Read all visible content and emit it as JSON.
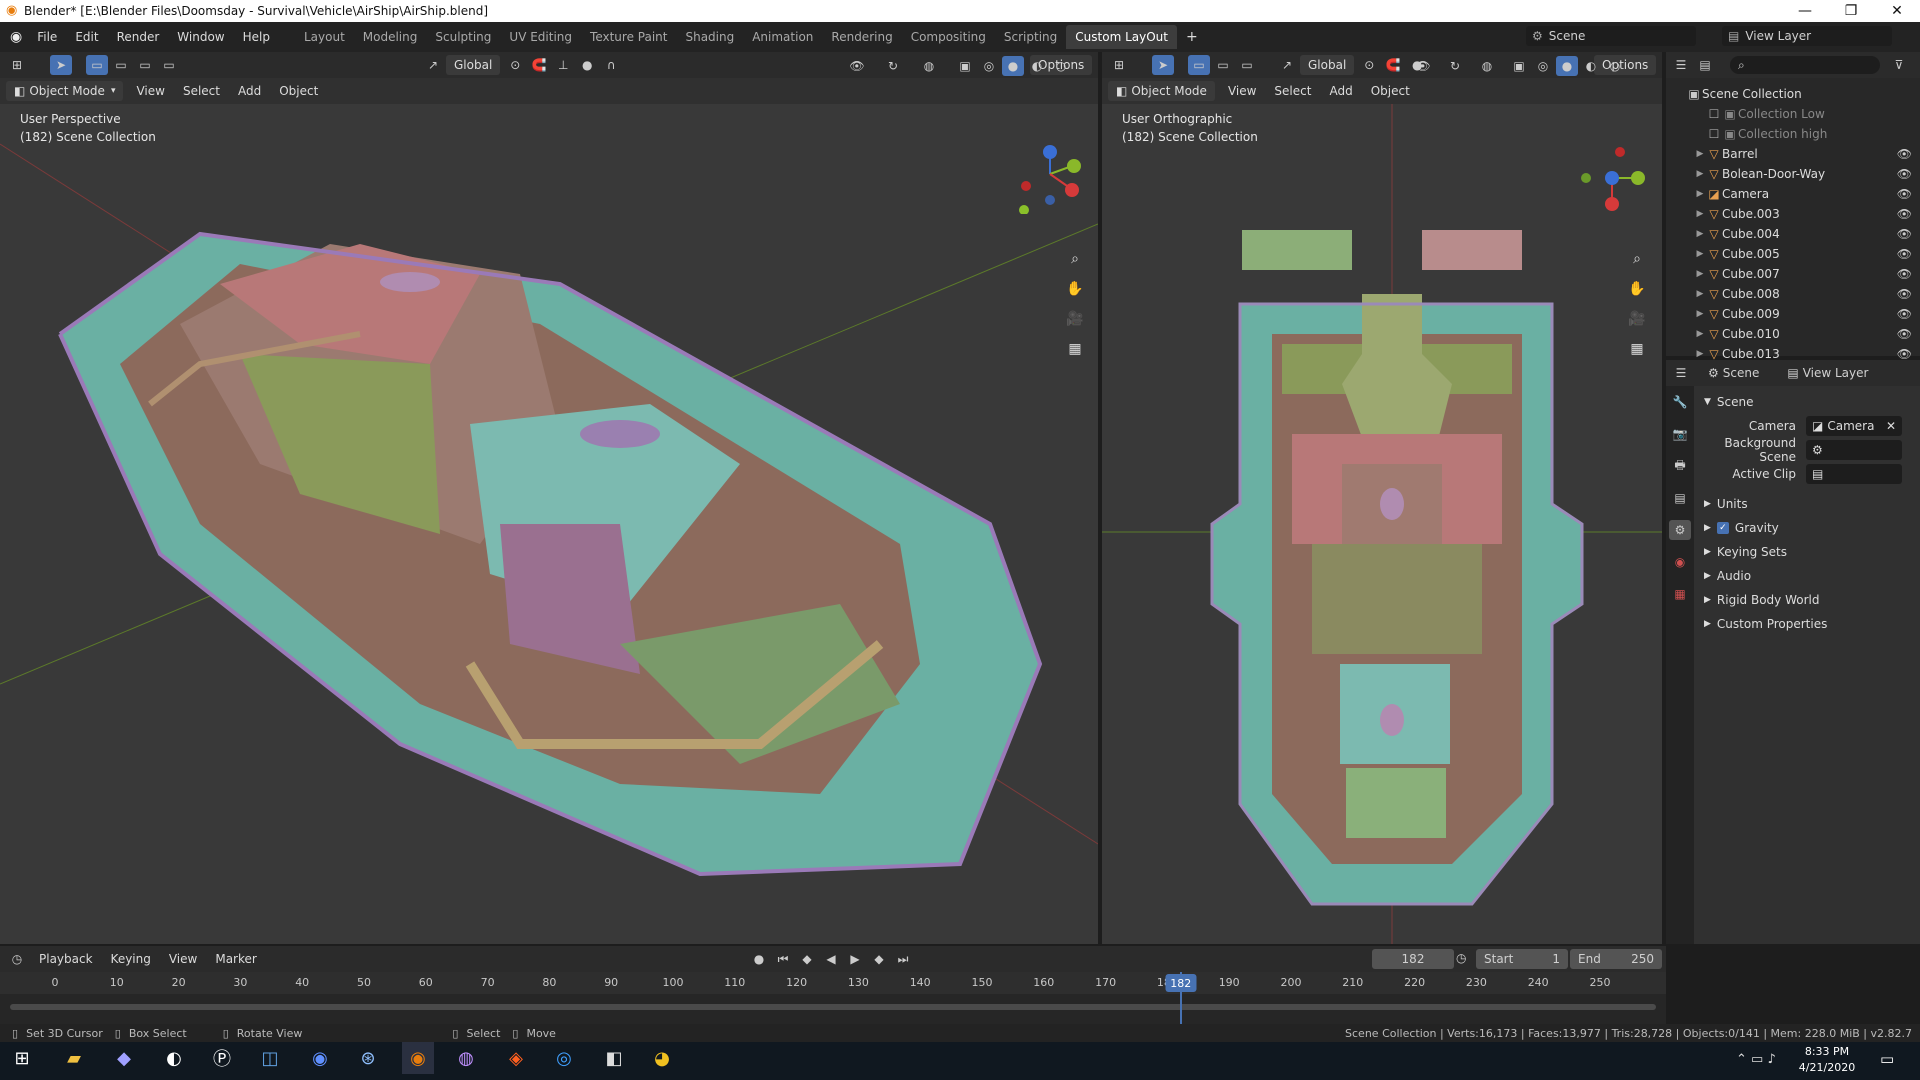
{
  "window": {
    "title": "Blender* [E:\\Blender Files\\Doomsday - Survival\\Vehicle\\AirShip\\AirShip.blend]"
  },
  "menu": [
    "File",
    "Edit",
    "Render",
    "Window",
    "Help"
  ],
  "workspaces": [
    "Layout",
    "Modeling",
    "Sculpting",
    "UV Editing",
    "Texture Paint",
    "Shading",
    "Animation",
    "Rendering",
    "Compositing",
    "Scripting",
    "Custom LayOut"
  ],
  "active_workspace": "Custom LayOut",
  "scene_selector": {
    "scene": "Scene",
    "view_layer": "View Layer"
  },
  "viewport_left": {
    "transform": "Global",
    "options": "Options",
    "mode": "Object Mode",
    "menus": [
      "View",
      "Select",
      "Add",
      "Object"
    ],
    "view_name": "User Perspective",
    "collection_info": "(182) Scene Collection"
  },
  "viewport_right": {
    "transform": "Global",
    "options": "Options",
    "mode": "Object Mode",
    "menus": [
      "View",
      "Select",
      "Add",
      "Object"
    ],
    "view_name": "User Orthographic",
    "collection_info": "(182) Scene Collection"
  },
  "outliner": {
    "root": "Scene Collection",
    "items": [
      "Collection Low",
      "Collection high",
      "Barrel",
      "Bolean-Door-Way",
      "Camera",
      "Cube.003",
      "Cube.004",
      "Cube.005",
      "Cube.007",
      "Cube.008",
      "Cube.009",
      "Cube.010",
      "Cube.013"
    ]
  },
  "properties": {
    "tabs": [
      "Scene",
      "View Layer"
    ],
    "section": "Scene",
    "camera_label": "Camera",
    "camera_value": "Camera",
    "background_scene_label": "Background Scene",
    "active_clip_label": "Active Clip",
    "panels": [
      "Units",
      "Gravity",
      "Keying Sets",
      "Audio",
      "Rigid Body World",
      "Custom Properties"
    ]
  },
  "timeline": {
    "menus": [
      "Playback",
      "Keying",
      "View",
      "Marker"
    ],
    "current_frame": "182",
    "start_label": "Start",
    "start": "1",
    "end_label": "End",
    "end": "250",
    "ticks": [
      "0",
      "10",
      "20",
      "30",
      "40",
      "50",
      "60",
      "70",
      "80",
      "90",
      "100",
      "110",
      "120",
      "130",
      "140",
      "150",
      "160",
      "170",
      "180",
      "190",
      "200",
      "210",
      "220",
      "230",
      "240",
      "250"
    ]
  },
  "statusbar": {
    "hints": [
      "Set 3D Cursor",
      "Box Select",
      "Rotate View",
      "Select",
      "Move"
    ],
    "stats": "Scene Collection | Verts:16,173 | Faces:13,977 | Tris:28,728 | Objects:0/141 | Mem: 228.0 MiB | v2.82.7"
  },
  "taskbar": {
    "time": "8:33 PM",
    "date": "4/21/2020"
  }
}
